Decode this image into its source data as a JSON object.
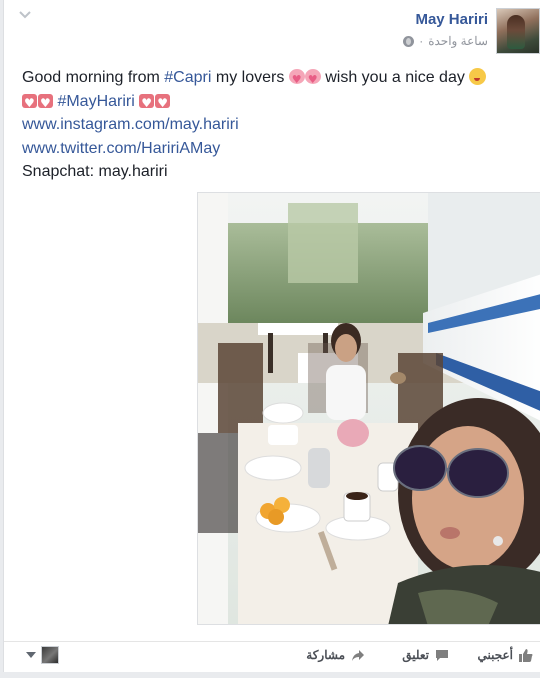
{
  "post": {
    "author": "May Hariri",
    "timestamp": "ساعة واحدة",
    "separator": "·",
    "text": {
      "greeting": "Good morning from ",
      "hashtag_capri": "#Capri",
      "mid": " my lovers ",
      "wish": " wish you a nice day ",
      "hashtag_mayhariri": "#MayHariri",
      "link_instagram": "www.instagram.com/may.hariri",
      "link_twitter": "www.twitter.com/HaririAMay",
      "snapchat": "Snapchat: may.hariri"
    }
  },
  "actions": {
    "like": "أعجبني",
    "comment": "تعليق",
    "share": "مشاركة"
  },
  "icons": [
    "chevron-down-icon",
    "globe-icon",
    "like-icon",
    "comment-icon",
    "share-icon",
    "dropdown-triangle-icon"
  ],
  "colors": {
    "link": "#365899",
    "text": "#1d2129",
    "meta": "#90949c",
    "action": "#4b4f56"
  }
}
